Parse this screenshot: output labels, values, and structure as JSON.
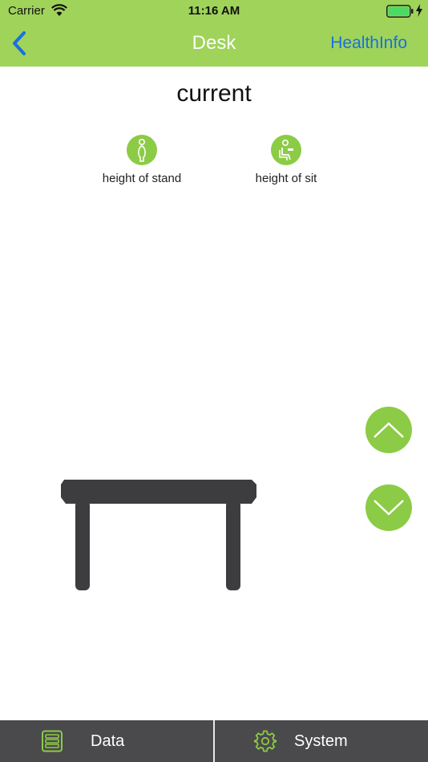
{
  "status_bar": {
    "carrier": "Carrier",
    "time": "11:16 AM",
    "icons": [
      "wifi-icon",
      "battery-icon",
      "charging-bolt-icon"
    ]
  },
  "nav": {
    "back_icon": "chevron-left-icon",
    "title": "Desk",
    "right_label": "HealthInfo"
  },
  "main": {
    "heading": "current",
    "presets": [
      {
        "label": "height of stand",
        "icon": "standing-person-icon"
      },
      {
        "label": "height of sit",
        "icon": "sitting-person-icon"
      }
    ],
    "desk_icon": "desk-icon",
    "controls": {
      "up_icon": "chevron-up-icon",
      "down_icon": "chevron-down-icon"
    }
  },
  "tabbar": {
    "tabs": [
      {
        "label": "Data",
        "icon": "data-list-icon"
      },
      {
        "label": "System",
        "icon": "gear-icon"
      }
    ]
  },
  "colors": {
    "header_green": "#9fd35a",
    "accent_green": "#8ccb45",
    "link_blue": "#1a6fe0",
    "tabbar_gray": "#4a4a4c",
    "desk_dark": "#3d3d40"
  }
}
